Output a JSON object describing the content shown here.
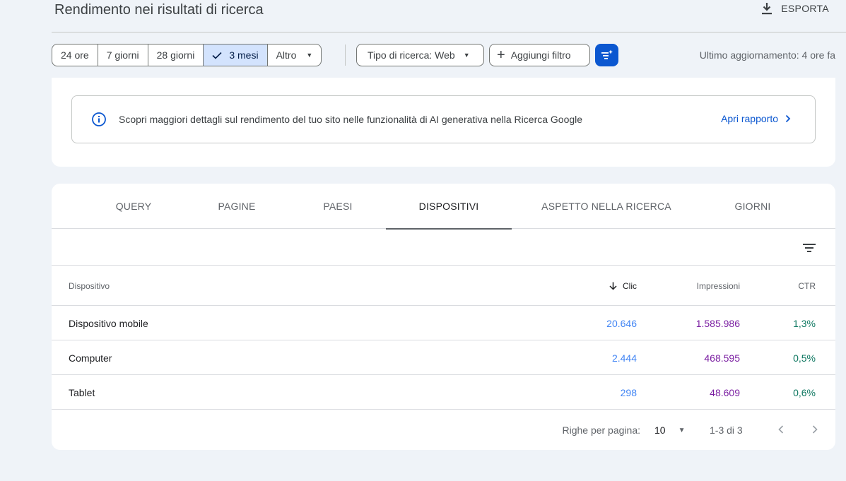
{
  "header": {
    "title": "Rendimento nei risultati di ricerca",
    "export_label": "ESPORTA",
    "export_icon": "download-icon"
  },
  "date_range": {
    "options": [
      "24 ore",
      "7 giorni",
      "28 giorni",
      "3 mesi",
      "Altro"
    ],
    "selected": "3 mesi"
  },
  "filters": {
    "search_type": "Tipo di ricerca: Web",
    "add_filter": "Aggiungi filtro",
    "last_updated": "Ultimo aggiornamento: 4 ore fa"
  },
  "banner": {
    "text": "Scopri maggiori dettagli sul rendimento del tuo sito nelle funzionalità di AI generativa nella Ricerca Google",
    "link": "Apri rapporto",
    "icon": "info-icon"
  },
  "tabs": [
    "QUERY",
    "PAGINE",
    "PAESI",
    "DISPOSITIVI",
    "ASPETTO NELLA RICERCA",
    "GIORNI"
  ],
  "active_tab": "DISPOSITIVI",
  "table": {
    "columns": [
      "Dispositivo",
      "Clic",
      "Impressioni",
      "CTR"
    ],
    "sort_column": "Clic",
    "rows": [
      [
        "Dispositivo mobile",
        "20.646",
        "1.585.986",
        "1,3%"
      ],
      [
        "Computer",
        "2.444",
        "468.595",
        "0,5%"
      ],
      [
        "Tablet",
        "298",
        "48.609",
        "0,6%"
      ]
    ]
  },
  "pagination": {
    "rows_per_page_label": "Righe per pagina:",
    "rows_per_page": "10",
    "range": "1-3 di 3"
  },
  "colors": {
    "accent": "#0b57d0",
    "clic": "#4285f4",
    "impressioni": "#7b1fa2",
    "ctr": "#0d7760",
    "selected_bg": "#d3e3fd",
    "page_bg": "#eff3f8"
  }
}
